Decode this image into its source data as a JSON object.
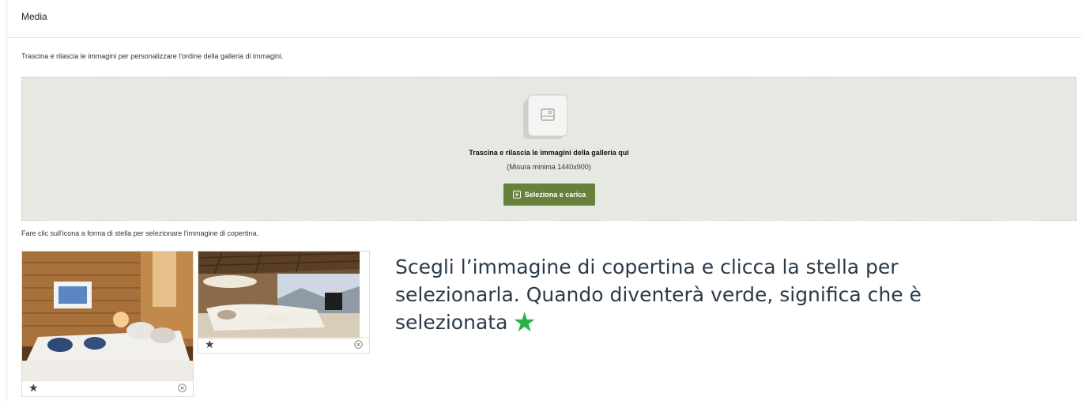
{
  "header": {
    "title": "Media"
  },
  "gallery_hint": "Trascina e rilascia le immagini per personalizzare l'ordine della galleria di immagini.",
  "dropzone": {
    "title": "Trascina e rilascia le immagini della galleria qui",
    "subtitle": "(Misura minima 1440x900)",
    "button_label": "Seleziona e carica",
    "icon": "image-upload-icon"
  },
  "cover_hint": "Fare clic sull'icona a forma di stella per selezionare l'immagine di copertina.",
  "images": [
    {
      "name": "bedroom-chalet",
      "star_icon": "★",
      "remove_icon": "close-circle-icon"
    },
    {
      "name": "living-room-chalet",
      "star_icon": "★",
      "remove_icon": "close-circle-icon"
    }
  ],
  "callout": {
    "text": "Scegli l’immagine di copertina e clicca la stella per selezionarla. Quando diventerà verde, significa che è selezionata",
    "star": "★",
    "star_color": "#2bb14a"
  },
  "colors": {
    "button_bg": "#67803a",
    "dropzone_bg": "#e6e9e1"
  }
}
